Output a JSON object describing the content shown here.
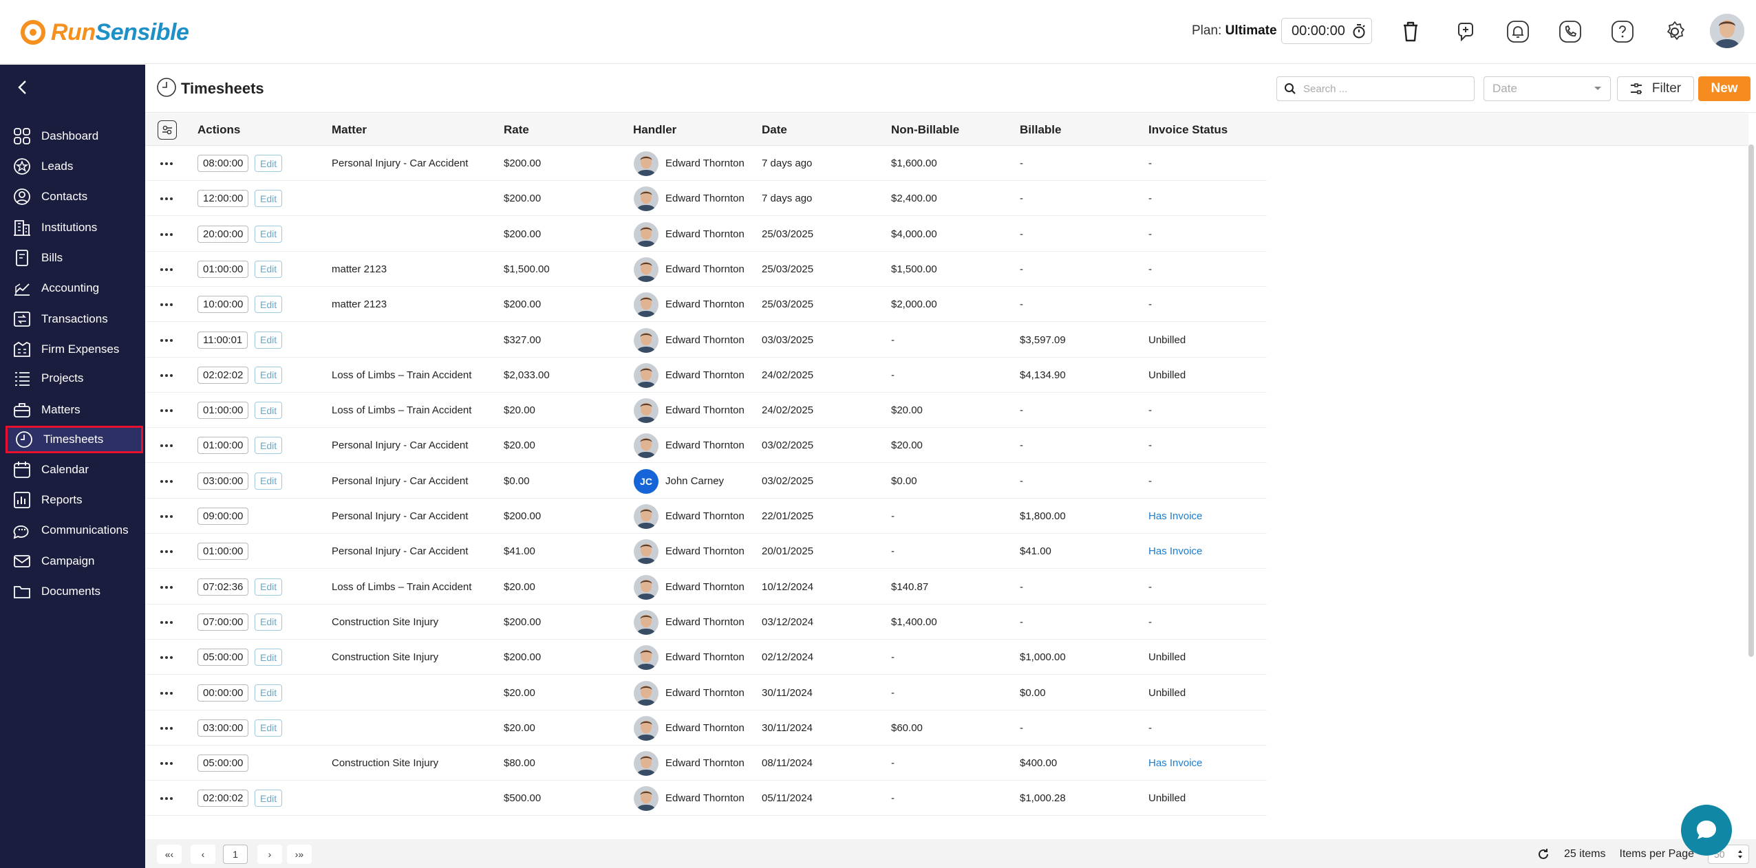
{
  "brand": {
    "name_part1": "Run",
    "name_part2": "Sensible"
  },
  "topbar": {
    "plan_label": "Plan:",
    "plan_value": "Ultimate",
    "timer": "00:00:00",
    "icons": [
      "trash-icon",
      "add-task-icon",
      "bell-icon",
      "phone-icon",
      "help-icon",
      "gear-icon"
    ]
  },
  "sidebar": {
    "items": [
      {
        "label": "Dashboard",
        "icon": "dashboard-icon"
      },
      {
        "label": "Leads",
        "icon": "star-icon"
      },
      {
        "label": "Contacts",
        "icon": "contact-icon"
      },
      {
        "label": "Institutions",
        "icon": "building-icon"
      },
      {
        "label": "Bills",
        "icon": "bill-icon"
      },
      {
        "label": "Accounting",
        "icon": "chart-icon"
      },
      {
        "label": "Transactions",
        "icon": "transactions-icon"
      },
      {
        "label": "Firm Expenses",
        "icon": "expenses-icon"
      },
      {
        "label": "Projects",
        "icon": "list-icon"
      },
      {
        "label": "Matters",
        "icon": "briefcase-icon"
      },
      {
        "label": "Timesheets",
        "icon": "clock-icon"
      },
      {
        "label": "Calendar",
        "icon": "calendar-icon"
      },
      {
        "label": "Reports",
        "icon": "reports-icon"
      },
      {
        "label": "Communications",
        "icon": "chat-icon"
      },
      {
        "label": "Campaign",
        "icon": "mail-icon"
      },
      {
        "label": "Documents",
        "icon": "folder-icon"
      }
    ],
    "active_index": 10
  },
  "page": {
    "title": "Timesheets",
    "search_placeholder": "Search ...",
    "date_placeholder": "Date",
    "filter_label": "Filter",
    "new_label": "New"
  },
  "table": {
    "columns": [
      "Actions",
      "Matter",
      "Rate",
      "Handler",
      "Date",
      "Non-Billable",
      "Billable",
      "Invoice Status"
    ],
    "edit_label": "Edit",
    "rows": [
      {
        "time": "08:00:00",
        "edit": true,
        "matter": "Personal Injury - Car Accident",
        "rate": "$200.00",
        "handler": "Edward Thornton",
        "initials": "",
        "date": "7 days ago",
        "nonbill": "$1,600.00",
        "bill": "-",
        "status": "-",
        "link": false
      },
      {
        "time": "12:00:00",
        "edit": true,
        "matter": "",
        "rate": "$200.00",
        "handler": "Edward Thornton",
        "initials": "",
        "date": "7 days ago",
        "nonbill": "$2,400.00",
        "bill": "-",
        "status": "-",
        "link": false
      },
      {
        "time": "20:00:00",
        "edit": true,
        "matter": "",
        "rate": "$200.00",
        "handler": "Edward Thornton",
        "initials": "",
        "date": "25/03/2025",
        "nonbill": "$4,000.00",
        "bill": "-",
        "status": "-",
        "link": false
      },
      {
        "time": "01:00:00",
        "edit": true,
        "matter": "matter 2123",
        "rate": "$1,500.00",
        "handler": "Edward Thornton",
        "initials": "",
        "date": "25/03/2025",
        "nonbill": "$1,500.00",
        "bill": "-",
        "status": "-",
        "link": false
      },
      {
        "time": "10:00:00",
        "edit": true,
        "matter": "matter 2123",
        "rate": "$200.00",
        "handler": "Edward Thornton",
        "initials": "",
        "date": "25/03/2025",
        "nonbill": "$2,000.00",
        "bill": "-",
        "status": "-",
        "link": false
      },
      {
        "time": "11:00:01",
        "edit": true,
        "matter": "",
        "rate": "$327.00",
        "handler": "Edward Thornton",
        "initials": "",
        "date": "03/03/2025",
        "nonbill": "-",
        "bill": "$3,597.09",
        "status": "Unbilled",
        "link": false
      },
      {
        "time": "02:02:02",
        "edit": true,
        "matter": "Loss of Limbs – Train Accident",
        "rate": "$2,033.00",
        "handler": "Edward Thornton",
        "initials": "",
        "date": "24/02/2025",
        "nonbill": "-",
        "bill": "$4,134.90",
        "status": "Unbilled",
        "link": false
      },
      {
        "time": "01:00:00",
        "edit": true,
        "matter": "Loss of Limbs – Train Accident",
        "rate": "$20.00",
        "handler": "Edward Thornton",
        "initials": "",
        "date": "24/02/2025",
        "nonbill": "$20.00",
        "bill": "-",
        "status": "-",
        "link": false
      },
      {
        "time": "01:00:00",
        "edit": true,
        "matter": "Personal Injury - Car Accident",
        "rate": "$20.00",
        "handler": "Edward Thornton",
        "initials": "",
        "date": "03/02/2025",
        "nonbill": "$20.00",
        "bill": "-",
        "status": "-",
        "link": false
      },
      {
        "time": "03:00:00",
        "edit": true,
        "matter": "Personal Injury - Car Accident",
        "rate": "$0.00",
        "handler": "John Carney",
        "initials": "JC",
        "date": "03/02/2025",
        "nonbill": "$0.00",
        "bill": "-",
        "status": "-",
        "link": false
      },
      {
        "time": "09:00:00",
        "edit": false,
        "matter": "Personal Injury - Car Accident",
        "rate": "$200.00",
        "handler": "Edward Thornton",
        "initials": "",
        "date": "22/01/2025",
        "nonbill": "-",
        "bill": "$1,800.00",
        "status": "Has Invoice",
        "link": true
      },
      {
        "time": "01:00:00",
        "edit": false,
        "matter": "Personal Injury - Car Accident",
        "rate": "$41.00",
        "handler": "Edward Thornton",
        "initials": "",
        "date": "20/01/2025",
        "nonbill": "-",
        "bill": "$41.00",
        "status": "Has Invoice",
        "link": true
      },
      {
        "time": "07:02:36",
        "edit": true,
        "matter": "Loss of Limbs – Train Accident",
        "rate": "$20.00",
        "handler": "Edward Thornton",
        "initials": "",
        "date": "10/12/2024",
        "nonbill": "$140.87",
        "bill": "-",
        "status": "-",
        "link": false
      },
      {
        "time": "07:00:00",
        "edit": true,
        "matter": "Construction Site Injury",
        "rate": "$200.00",
        "handler": "Edward Thornton",
        "initials": "",
        "date": "03/12/2024",
        "nonbill": "$1,400.00",
        "bill": "-",
        "status": "-",
        "link": false
      },
      {
        "time": "05:00:00",
        "edit": true,
        "matter": "Construction Site Injury",
        "rate": "$200.00",
        "handler": "Edward Thornton",
        "initials": "",
        "date": "02/12/2024",
        "nonbill": "-",
        "bill": "$1,000.00",
        "status": "Unbilled",
        "link": false
      },
      {
        "time": "00:00:00",
        "edit": true,
        "matter": "",
        "rate": "$20.00",
        "handler": "Edward Thornton",
        "initials": "",
        "date": "30/11/2024",
        "nonbill": "-",
        "bill": "$0.00",
        "status": "Unbilled",
        "link": false
      },
      {
        "time": "03:00:00",
        "edit": true,
        "matter": "",
        "rate": "$20.00",
        "handler": "Edward Thornton",
        "initials": "",
        "date": "30/11/2024",
        "nonbill": "$60.00",
        "bill": "-",
        "status": "-",
        "link": false
      },
      {
        "time": "05:00:00",
        "edit": false,
        "matter": "Construction Site Injury",
        "rate": "$80.00",
        "handler": "Edward Thornton",
        "initials": "",
        "date": "08/11/2024",
        "nonbill": "-",
        "bill": "$400.00",
        "status": "Has Invoice",
        "link": true
      },
      {
        "time": "02:00:02",
        "edit": true,
        "matter": "",
        "rate": "$500.00",
        "handler": "Edward Thornton",
        "initials": "",
        "date": "05/11/2024",
        "nonbill": "-",
        "bill": "$1,000.28",
        "status": "Unbilled",
        "link": false
      }
    ]
  },
  "pagination": {
    "first": "«‹",
    "prev": "‹",
    "current": "1",
    "next": "›",
    "last": "›»",
    "items_count": "25 items",
    "items_per_page_label": "Items per Page",
    "per_page_value": "50"
  },
  "colors": {
    "sidebar_bg": "#1b1d3f",
    "accent_orange": "#f68b1f",
    "link_blue": "#1a7ed6",
    "active_outline": "#e8112d"
  }
}
